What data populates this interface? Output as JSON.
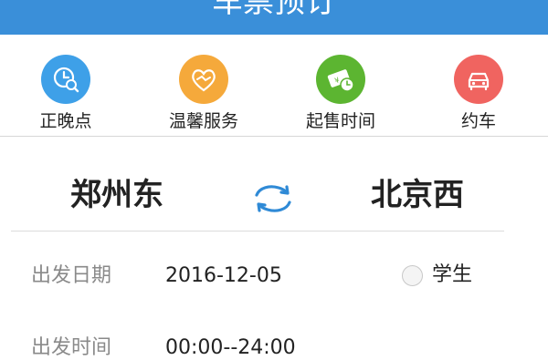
{
  "header": {
    "title": "车票预订"
  },
  "quick_actions": [
    {
      "label": "正晚点",
      "icon": "clock-search-icon",
      "color": "#3ea0e8"
    },
    {
      "label": "温馨服务",
      "icon": "heart-handshake-icon",
      "color": "#f5a93b"
    },
    {
      "label": "起售时间",
      "icon": "ticket-clock-icon",
      "color": "#5cb531"
    },
    {
      "label": "约车",
      "icon": "car-icon",
      "color": "#f06460"
    }
  ],
  "route": {
    "from": "郑州东",
    "to": "北京西",
    "swap_icon": "swap-arrows-icon"
  },
  "form": {
    "date_label": "出发日期",
    "date_value": "2016-12-05",
    "student_label": "学生",
    "student_checked": false,
    "time_label": "出发时间",
    "time_value": "00:00--24:00"
  },
  "colors": {
    "header": "#3a8fd9",
    "accent": "#2f8ad6"
  }
}
